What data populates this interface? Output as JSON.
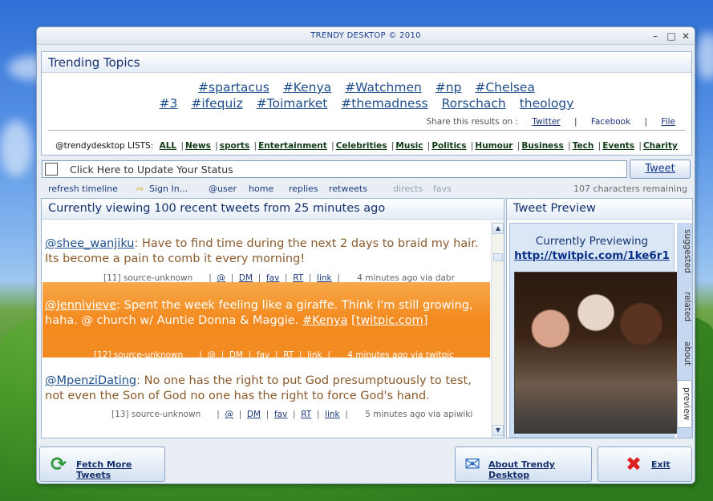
{
  "window": {
    "title": "TRENDY DESKTOP © 2010"
  },
  "trending": {
    "title": "Trending Topics",
    "row1": [
      "#spartacus",
      "#Kenya",
      "#Watchmen",
      "#np",
      "#Chelsea"
    ],
    "row2": [
      "#3",
      "#ifequiz",
      "#Toimarket",
      "#themadness",
      "Rorschach",
      "theology"
    ],
    "share_label": "Share this results on :",
    "share_links": [
      "Twitter",
      "Facebook",
      "File"
    ],
    "lists_label": "@trendydesktop LISTS:",
    "lists": [
      "ALL",
      "News",
      "sports",
      "Entertainment",
      "Celebrities",
      "Music",
      "Politics",
      "Humour",
      "Business",
      "Tech",
      "Events",
      "Charity"
    ]
  },
  "status": {
    "placeholder": "Click Here to Update Your Status",
    "tweet_button": "Tweet"
  },
  "toolbar": {
    "refresh": "refresh timeline",
    "signin": "Sign In...",
    "user": "@user",
    "home": "home",
    "replies": "replies",
    "retweets": "retweets",
    "directs": "directs",
    "favs": "favs",
    "remaining": "107 characters remaining"
  },
  "feed": {
    "title": "Currently viewing 100 recent tweets from 25 minutes ago",
    "tweets": [
      {
        "user": "@shee_wanjiku",
        "text": ": Have to find time during the next 2 days to braid my hair. Its become a pain to comb it every morning!",
        "index": "[11]",
        "source": "source-unknown",
        "actions": [
          "@",
          "DM",
          "fav",
          "RT",
          "link"
        ],
        "time": "4 minutes ago via dabr"
      },
      {
        "user": "@Jennivieve",
        "text": ": Spent the week feeling like a giraffe. Think I'm still growing, haha. @ church w/ Auntie Donna & Maggie.",
        "hashtag": "#Kenya",
        "link": "[twitpic.com]",
        "index": "[12]",
        "source": "source-unknown",
        "actions": [
          "@",
          "DM",
          "fav",
          "RT",
          "link"
        ],
        "time": "4 minutes ago via twitpic"
      },
      {
        "user": "@MpenziDating",
        "text": ": No one has the right to put God presumptuously to test, not even the Son of God no one has the right to force God's hand.",
        "index": "[13]",
        "source": "source-unknown",
        "actions": [
          "@",
          "DM",
          "fav",
          "RT",
          "link"
        ],
        "time": "5 minutes ago via apiwiki"
      }
    ]
  },
  "preview": {
    "title": "Tweet Preview",
    "label": "Currently Previewing",
    "url": "http://twitpic.com/1ke6r1",
    "tabs": [
      "suggested",
      "related",
      "about",
      "preview"
    ]
  },
  "footer": {
    "fetch": "Fetch More Tweets",
    "about": "About Trendy Desktop",
    "exit": "Exit"
  }
}
